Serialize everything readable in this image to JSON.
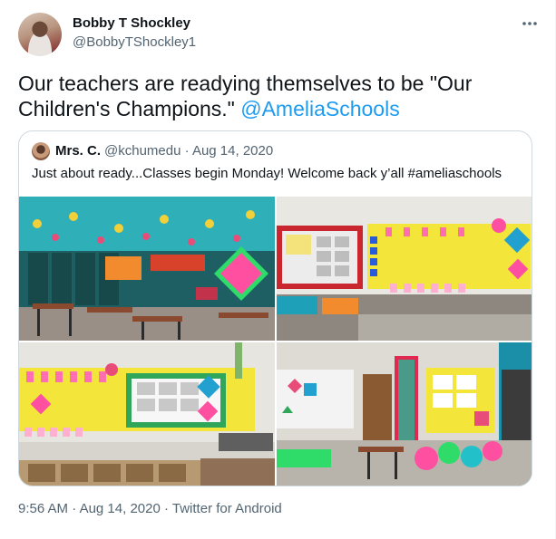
{
  "author": {
    "display_name": "Bobby T Shockley",
    "handle": "@BobbyTShockley1",
    "avatar_icon": "user-avatar"
  },
  "more_icon": "more-horizontal-icon",
  "tweet": {
    "text": "Our teachers are readying themselves to be \"Our Children's Champions.\" ",
    "mention": "@AmeliaSchools"
  },
  "quoted_tweet": {
    "display_name": "Mrs. C.",
    "handle": "@kchumedu",
    "separator": "·",
    "date": "Aug 14, 2020",
    "text": "Just about ready...Classes begin Monday!  Welcome back y’all #ameliaschools"
  },
  "photos": [
    {
      "name": "classroom-lockers-photo"
    },
    {
      "name": "bulletin-board-word-wall-photo"
    },
    {
      "name": "yellow-bulletin-board-photo"
    },
    {
      "name": "classroom-corner-photo"
    }
  ],
  "footer": {
    "time": "9:56 AM",
    "separator": "·",
    "date": "Aug 14, 2020",
    "source": "Twitter for Android"
  },
  "colors": {
    "accent": "#1d9bf0",
    "text_primary": "#0f1419",
    "text_secondary": "#536471",
    "border": "#cfd9de"
  }
}
